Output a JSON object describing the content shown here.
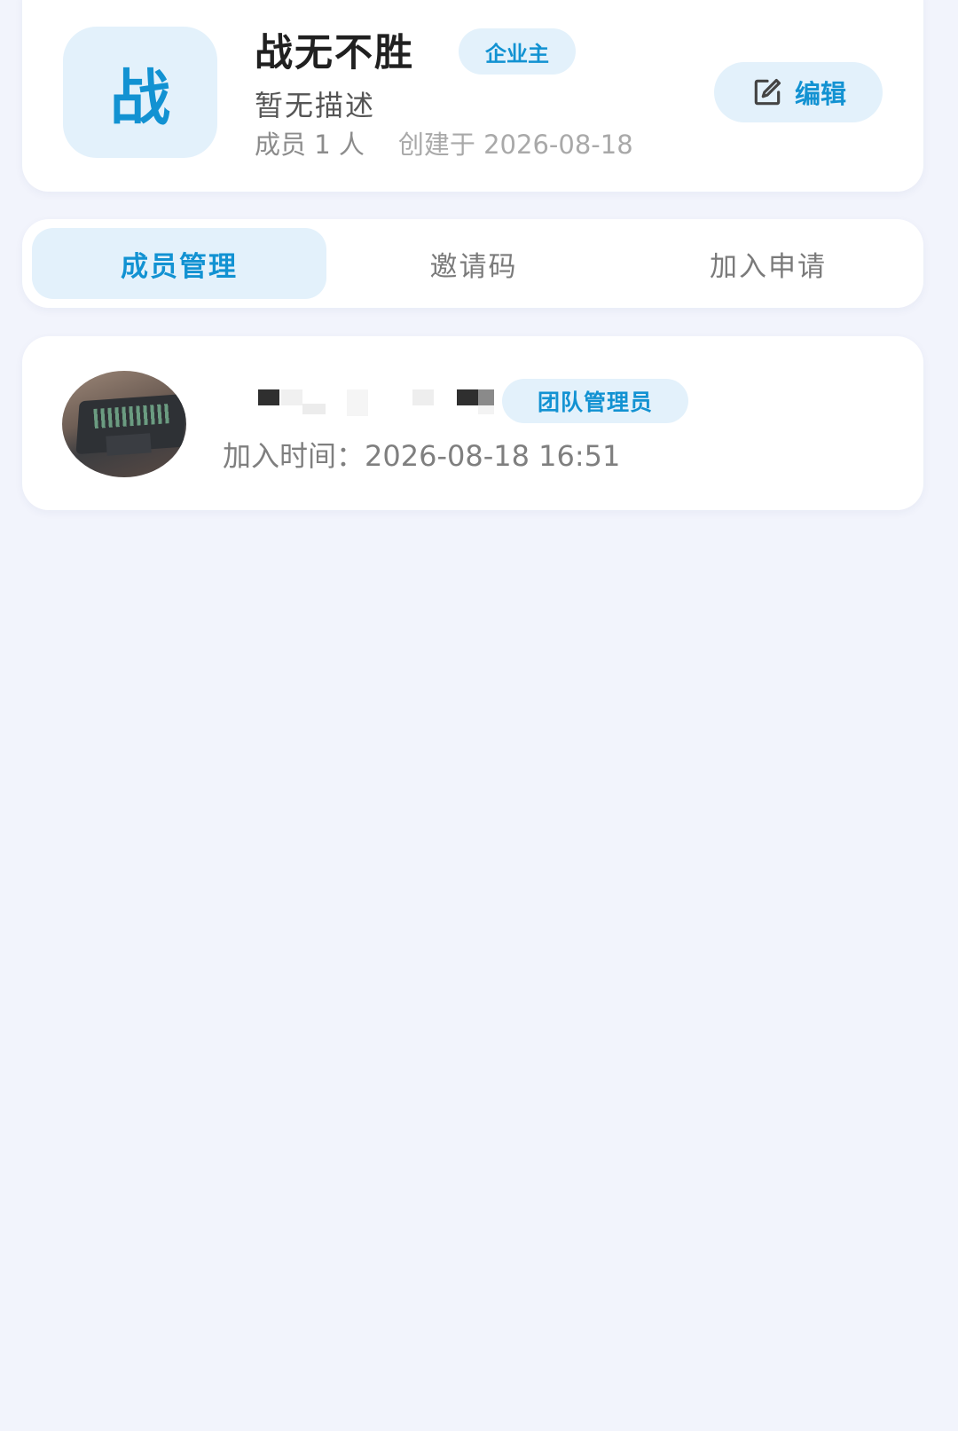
{
  "team": {
    "avatar_char": "战",
    "name": "战无不胜",
    "role_badge": "企业主",
    "description": "暂无描述",
    "member_count": "成员 1 人",
    "created": "创建于 2026-08-18",
    "edit_label": "编辑"
  },
  "tabs": [
    {
      "label": "成员管理",
      "active": true
    },
    {
      "label": "邀请码",
      "active": false
    },
    {
      "label": "加入申请",
      "active": false
    }
  ],
  "members": [
    {
      "role": "团队管理员",
      "joined": "加入时间：2026-08-18 16:51"
    }
  ],
  "colors": {
    "accent": "#1292d2",
    "accent_bg": "#e3f1fb",
    "page_bg": "#f2f4fc"
  },
  "icons": {
    "edit": "edit-icon"
  }
}
